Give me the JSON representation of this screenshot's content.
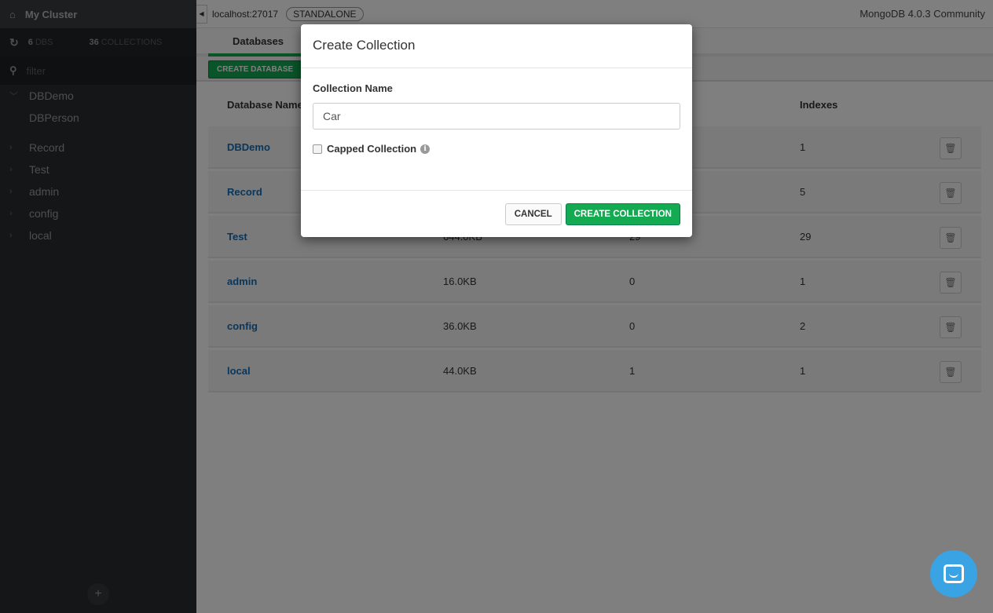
{
  "sidebar": {
    "cluster": "My Cluster",
    "dbs_count": "6",
    "dbs_label": "DBS",
    "collections_count": "36",
    "collections_label": "COLLECTIONS",
    "filter_placeholder": "filter",
    "tree": [
      {
        "name": "DBDemo",
        "expanded": true,
        "children": [
          "DBPerson"
        ]
      },
      {
        "name": "Record"
      },
      {
        "name": "Test"
      },
      {
        "name": "admin"
      },
      {
        "name": "config"
      },
      {
        "name": "local"
      }
    ],
    "add": "+"
  },
  "topbar": {
    "host": "localhost:27017",
    "topology": "STANDALONE",
    "version": "MongoDB 4.0.3 Community"
  },
  "tabs": [
    "Databases"
  ],
  "toolbar": {
    "create_database": "CREATE DATABASE"
  },
  "table": {
    "headers": {
      "name": "Database Name",
      "indexes": "Indexes"
    },
    "rows": [
      {
        "name": "DBDemo",
        "storage": "",
        "collections": "",
        "indexes": "1"
      },
      {
        "name": "Record",
        "storage": "",
        "collections": "",
        "indexes": "5"
      },
      {
        "name": "Test",
        "storage": "644.0KB",
        "collections": "29",
        "indexes": "29"
      },
      {
        "name": "admin",
        "storage": "16.0KB",
        "collections": "0",
        "indexes": "1"
      },
      {
        "name": "config",
        "storage": "36.0KB",
        "collections": "0",
        "indexes": "2"
      },
      {
        "name": "local",
        "storage": "44.0KB",
        "collections": "1",
        "indexes": "1"
      }
    ]
  },
  "modal": {
    "title": "Create Collection",
    "name_label": "Collection Name",
    "name_value": "Car",
    "capped_label": "Capped Collection",
    "capped_checked": false,
    "cancel": "CANCEL",
    "create": "CREATE COLLECTION"
  },
  "colors": {
    "accent": "#13aa52",
    "link": "#136db5",
    "chat": "#3aa3e3"
  }
}
